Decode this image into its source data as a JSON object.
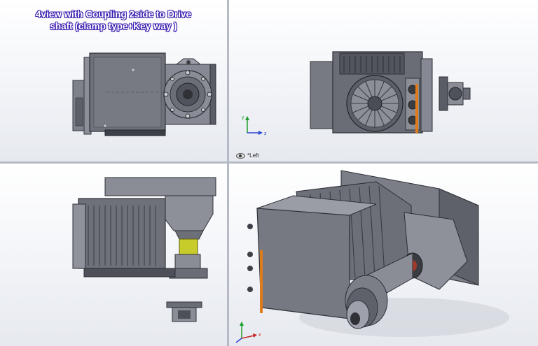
{
  "title": {
    "line1": "4view with Coupling 2side to Drive",
    "line2": "shaft (clamp type+Key way )"
  },
  "view_label": "*Left",
  "triad": {
    "y": "y",
    "z": "z",
    "x": "x"
  },
  "colors": {
    "body": "#6f717a",
    "body_light": "#9ea1ab",
    "body_dark": "#3e4048",
    "coupling_yellow": "#c8cc2a",
    "accent_orange": "#e07b1a",
    "title_outline": "#3c1fb0",
    "background_top": "#ffffff",
    "background_bottom": "#e6e9ef"
  },
  "icons": [
    "eye-icon",
    "axis-triad-icon"
  ]
}
